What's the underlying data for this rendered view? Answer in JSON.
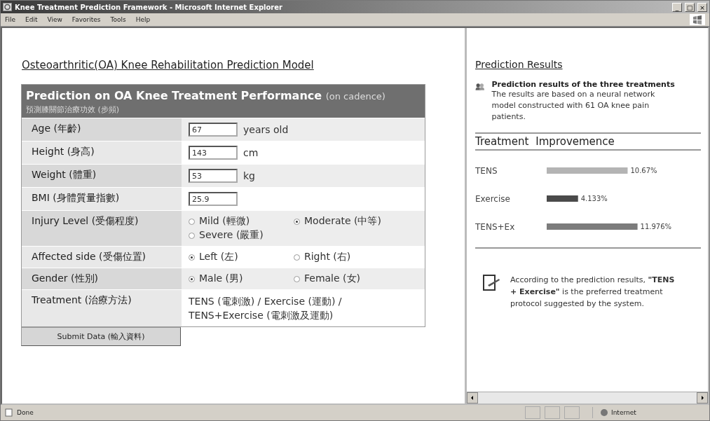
{
  "window": {
    "title": "Knee Treatment Prediction Framework - Microsoft Internet Explorer",
    "controls": [
      "_",
      "□",
      "×"
    ]
  },
  "menu": [
    "File",
    "Edit",
    "View",
    "Favorites",
    "Tools",
    "Help"
  ],
  "form": {
    "heading": "Osteoarthritic(OA) Knee Rehabilitation Prediction Model",
    "table_title": "Prediction on OA Knee Treatment Performance",
    "table_note": "(on cadence)",
    "table_subtitle": "預測膝關節治療功效 (步頻)",
    "rows": [
      {
        "label": "Age (年齡)",
        "kind": "input",
        "value": "67",
        "unit": "years old"
      },
      {
        "label": "Height (身高)",
        "kind": "input",
        "value": "143",
        "unit": "cm"
      },
      {
        "label": "Weight (體重)",
        "kind": "input",
        "value": "53",
        "unit": "kg"
      },
      {
        "label": "BMI (身體質量指數)",
        "kind": "input",
        "value": "25.9"
      },
      {
        "label": "Injury Level (受傷程度)",
        "kind": "radio",
        "options": [
          {
            "label": "Mild (輕微)",
            "selected": false
          },
          {
            "label": "Moderate (中等)",
            "selected": true
          },
          {
            "label": "Severe (嚴重)",
            "selected": false
          }
        ]
      },
      {
        "label": "Affected side (受傷位置)",
        "kind": "radio",
        "options": [
          {
            "label": "Left (左)",
            "selected": true
          },
          {
            "label": "Right (右)",
            "selected": false
          }
        ]
      },
      {
        "label": "Gender (性別)",
        "kind": "radio",
        "options": [
          {
            "label": "Male (男)",
            "selected": true
          },
          {
            "label": "Female (女)",
            "selected": false
          }
        ]
      },
      {
        "label": "Treatment (治療方法)",
        "kind": "text",
        "lines": [
          "TENS (電刺激) / Exercise (運動) /",
          "TENS+Exercise (電刺激及運動)"
        ]
      }
    ],
    "submit": "Submit Data (輸入資料)"
  },
  "results": {
    "heading": "Prediction Results",
    "intro_title": "Prediction results of the three treatments",
    "intro_text": "The results are based on a neural network model constructed with 61 OA knee pain patients.",
    "columns": [
      "Treatment"
    ],
    "chart_data": {
      "type": "bar",
      "orientation": "horizontal",
      "categories": [
        "TENS",
        "Exercise",
        "TENS+Ex"
      ],
      "series": [
        {
          "name": "Improvemence",
          "values": [
            10.67,
            4.133,
            11.976
          ],
          "value_labels": [
            "10.67%",
            "4.133%",
            "11.976%"
          ]
        }
      ],
      "colors": [
        "#b4b4b4",
        "#4a4a4a",
        "#7c7c7c"
      ]
    },
    "conclusion": "According to the prediction results, **\"TENS + Exercise\"** is the preferred treatment protocol suggested by the system."
  },
  "status_bar": {
    "text": "Done",
    "zone": "Internet"
  }
}
